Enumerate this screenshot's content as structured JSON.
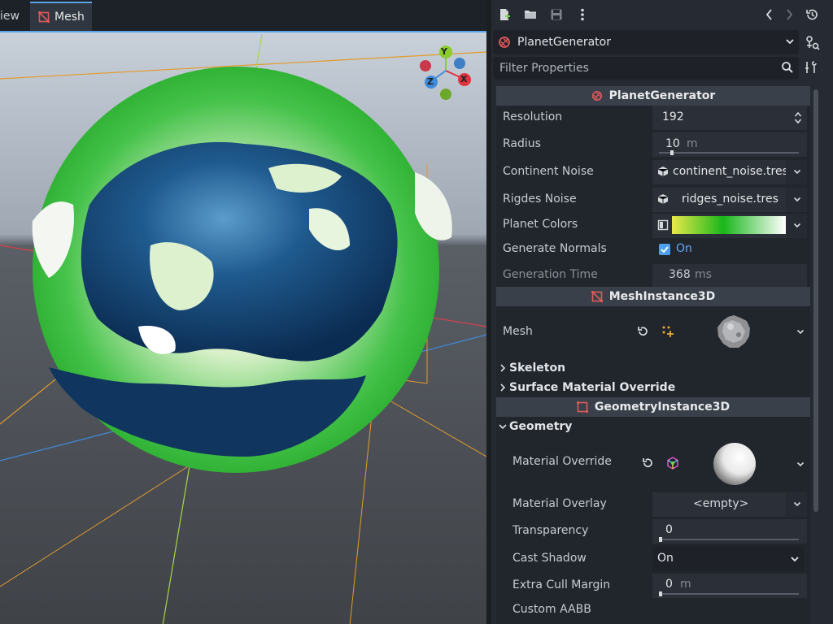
{
  "tabs": {
    "view_label": "iew",
    "mesh_label": "Mesh"
  },
  "gizmo": {
    "y": "Y",
    "z": "Z",
    "x": "X"
  },
  "inspector": {
    "node_name": "PlanetGenerator",
    "filter_placeholder": "Filter Properties",
    "sections": {
      "planet_generator": "PlanetGenerator",
      "mesh_instance": "MeshInstance3D",
      "geometry_instance": "GeometryInstance3D"
    },
    "props": {
      "resolution_label": "Resolution",
      "resolution_value": "192",
      "radius_label": "Radius",
      "radius_value": "10",
      "radius_unit": "m",
      "continent_noise_label": "Continent Noise",
      "continent_noise_value": "continent_noise.tres",
      "ridges_noise_label": "Rigdes Noise",
      "ridges_noise_value": "ridges_noise.tres",
      "planet_colors_label": "Planet Colors",
      "generate_normals_label": "Generate Normals",
      "generate_normals_value": "On",
      "generation_time_label": "Generation Time",
      "generation_time_value": "368",
      "generation_time_unit": "ms",
      "mesh_label": "Mesh",
      "skeleton_label": "Skeleton",
      "surface_override_label": "Surface Material Override",
      "geometry_label": "Geometry",
      "material_override_label": "Material Override",
      "material_overlay_label": "Material Overlay",
      "material_overlay_value": "<empty>",
      "transparency_label": "Transparency",
      "transparency_value": "0",
      "cast_shadow_label": "Cast Shadow",
      "cast_shadow_value": "On",
      "extra_cull_label": "Extra Cull Margin",
      "extra_cull_value": "0",
      "extra_cull_unit": "m",
      "custom_aabb_label": "Custom AABB"
    }
  },
  "colors": {
    "accent": "#5ea3e8",
    "node_icon": "#e05a5a",
    "gizmo_x": "#e0323c",
    "gizmo_y": "#8bcc2a",
    "gizmo_z": "#3f8ad8",
    "gradient": [
      "#e9e84a",
      "#19b71b",
      "#ffffff"
    ]
  }
}
